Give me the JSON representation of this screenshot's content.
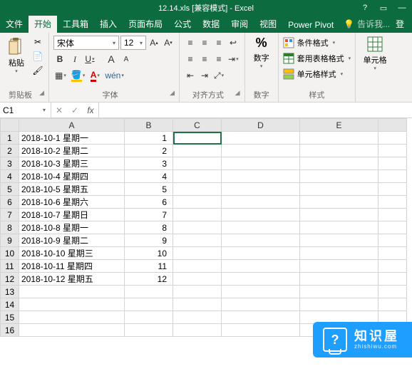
{
  "title": "12.14.xls  [兼容模式] - Excel",
  "tabs": {
    "file": "文件",
    "home": "开始",
    "toolbox": "工具箱",
    "insert": "插入",
    "layout": "页面布局",
    "formulas": "公式",
    "data": "数据",
    "review": "审阅",
    "view": "视图",
    "pivot": "Power Pivot",
    "tell": "告诉我...",
    "tell_extra": "登"
  },
  "ribbon": {
    "clipboard": {
      "paste": "粘贴",
      "label": "剪贴板"
    },
    "font": {
      "name": "宋体",
      "size": "12",
      "label": "字体",
      "wen": "wén"
    },
    "align": {
      "label": "对齐方式"
    },
    "number": {
      "btn": "数字",
      "label": "数字",
      "pct": "%"
    },
    "styles": {
      "cond": "条件格式",
      "table": "套用表格格式",
      "cell": "单元格样式",
      "label": "样式"
    },
    "cells": {
      "btn": "单元格"
    }
  },
  "namebox": "C1",
  "columns": [
    "A",
    "B",
    "C",
    "D",
    "E"
  ],
  "rows": [
    {
      "n": 1,
      "a": "2018-10-1 星期一",
      "b": "1"
    },
    {
      "n": 2,
      "a": "2018-10-2 星期二",
      "b": "2"
    },
    {
      "n": 3,
      "a": "2018-10-3 星期三",
      "b": "3"
    },
    {
      "n": 4,
      "a": "2018-10-4 星期四",
      "b": "4"
    },
    {
      "n": 5,
      "a": "2018-10-5 星期五",
      "b": "5"
    },
    {
      "n": 6,
      "a": "2018-10-6 星期六",
      "b": "6"
    },
    {
      "n": 7,
      "a": "2018-10-7 星期日",
      "b": "7"
    },
    {
      "n": 8,
      "a": "2018-10-8 星期一",
      "b": "8"
    },
    {
      "n": 9,
      "a": "2018-10-9 星期二",
      "b": "9"
    },
    {
      "n": 10,
      "a": "2018-10-10 星期三",
      "b": "10"
    },
    {
      "n": 11,
      "a": "2018-10-11 星期四",
      "b": "11"
    },
    {
      "n": 12,
      "a": "2018-10-12 星期五",
      "b": "12"
    },
    {
      "n": 13,
      "a": "",
      "b": ""
    },
    {
      "n": 14,
      "a": "",
      "b": ""
    },
    {
      "n": 15,
      "a": "",
      "b": ""
    },
    {
      "n": 16,
      "a": "",
      "b": ""
    }
  ],
  "watermark": {
    "cn": "知识屋",
    "py": "zhishiwu.com",
    "q": "?"
  }
}
